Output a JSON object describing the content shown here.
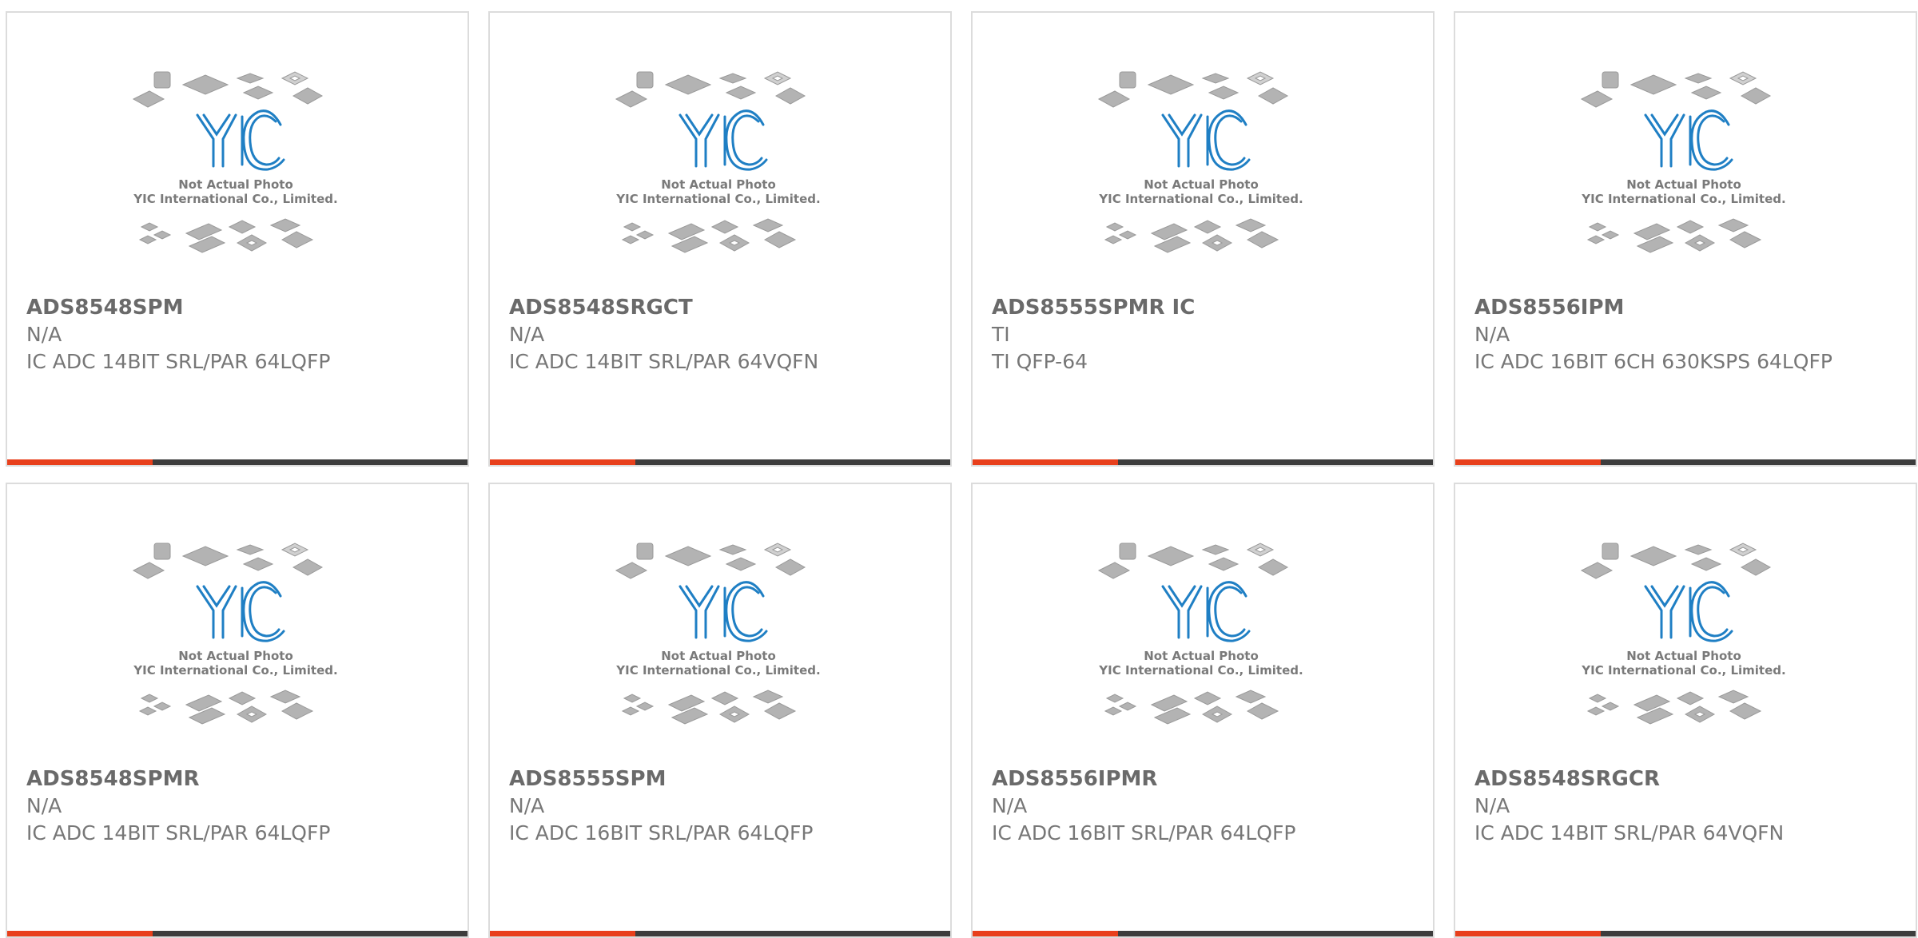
{
  "placeholder": {
    "line1": "Not Actual Photo",
    "line2": "YIC International Co., Limited.",
    "logo": "YIC"
  },
  "colors": {
    "accent": "#e8401c",
    "bar": "#3d3d3d",
    "logo_blue": "#1f7fc4"
  },
  "products": [
    {
      "part": "ADS8548SPM",
      "manufacturer": "N/A",
      "description": "IC ADC 14BIT SRL/PAR 64LQFP"
    },
    {
      "part": "ADS8548SRGCT",
      "manufacturer": "N/A",
      "description": "IC ADC 14BIT SRL/PAR 64VQFN"
    },
    {
      "part": "ADS8555SPMR IC",
      "manufacturer": "TI",
      "description": "TI QFP-64"
    },
    {
      "part": "ADS8556IPM",
      "manufacturer": "N/A",
      "description": "IC ADC 16BIT 6CH 630KSPS 64LQFP"
    },
    {
      "part": "ADS8548SPMR",
      "manufacturer": "N/A",
      "description": "IC ADC 14BIT SRL/PAR 64LQFP"
    },
    {
      "part": "ADS8555SPM",
      "manufacturer": "N/A",
      "description": "IC ADC 16BIT SRL/PAR 64LQFP"
    },
    {
      "part": "ADS8556IPMR",
      "manufacturer": "N/A",
      "description": "IC ADC 16BIT SRL/PAR 64LQFP"
    },
    {
      "part": "ADS8548SRGCR",
      "manufacturer": "N/A",
      "description": "IC ADC 14BIT SRL/PAR 64VQFN"
    }
  ]
}
